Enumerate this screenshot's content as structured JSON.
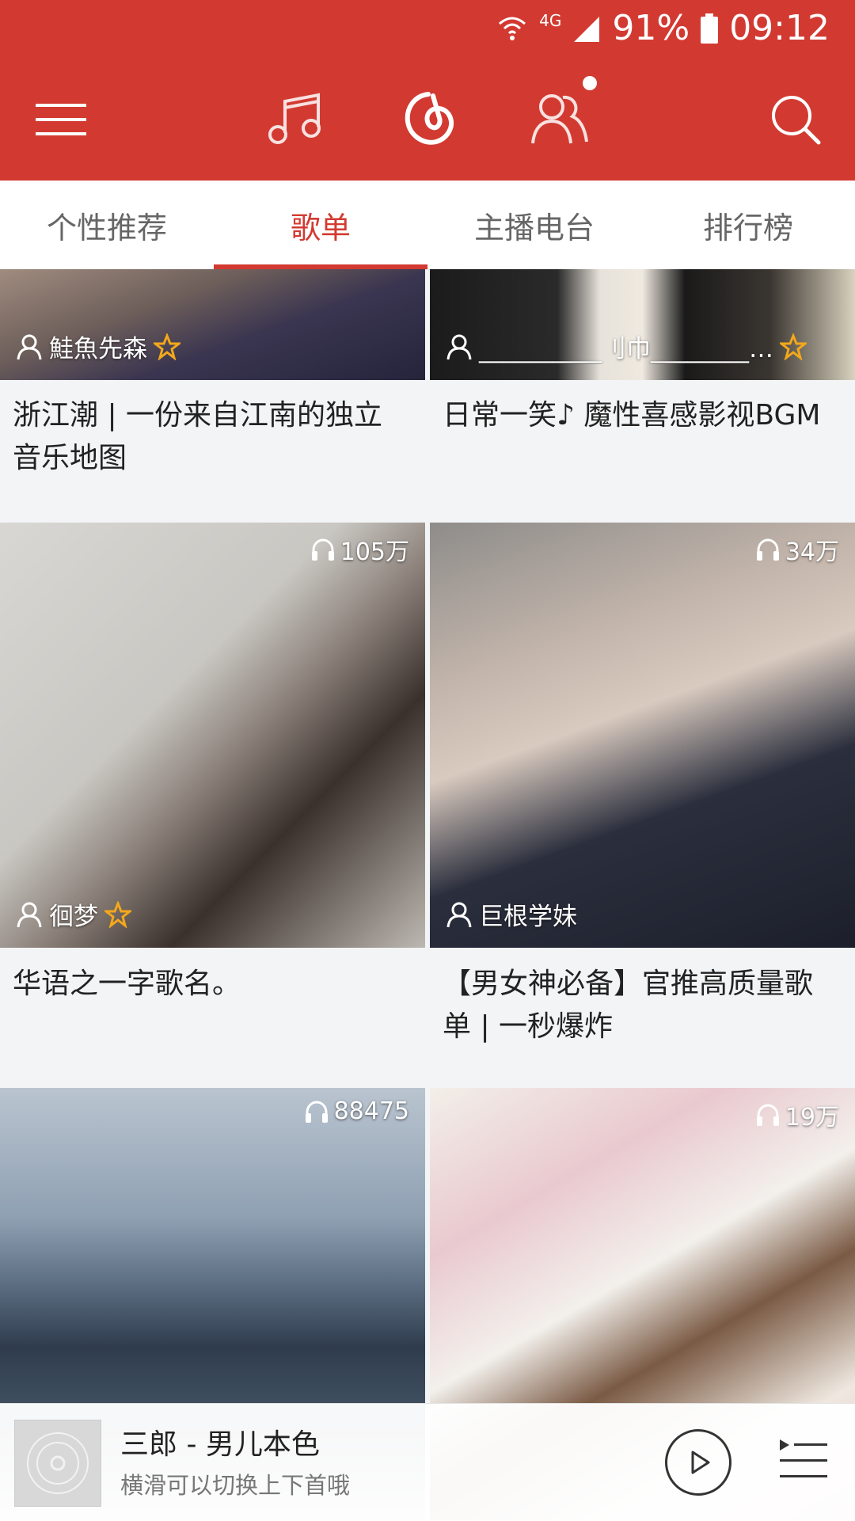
{
  "status": {
    "network": "4G",
    "battery": "91%",
    "time": "09:12"
  },
  "tabs": [
    {
      "label": "个性推荐"
    },
    {
      "label": "歌单"
    },
    {
      "label": "主播电台"
    },
    {
      "label": "排行榜"
    }
  ],
  "cards": [
    {
      "creator": "鮭魚先森",
      "title": "浙江潮 | 一份来自江南的独立音乐地图"
    },
    {
      "creator": "__________刂巾________…",
      "title": "日常一笑♪ 魔性喜感影视BGM"
    },
    {
      "count": "105万",
      "creator": "徊梦",
      "title": "华语之一字歌名。"
    },
    {
      "count": "34万",
      "creator": "巨根学妹",
      "title": "【男女神必备】官推高质量歌单 | 一秒爆炸"
    },
    {
      "count": "88475"
    },
    {
      "count": "19万"
    }
  ],
  "player": {
    "song": "三郎 - 男儿本色",
    "hint": "横滑可以切换上下首哦"
  },
  "colors": {
    "accent": "#d23a31",
    "star": "#f3a81b"
  }
}
